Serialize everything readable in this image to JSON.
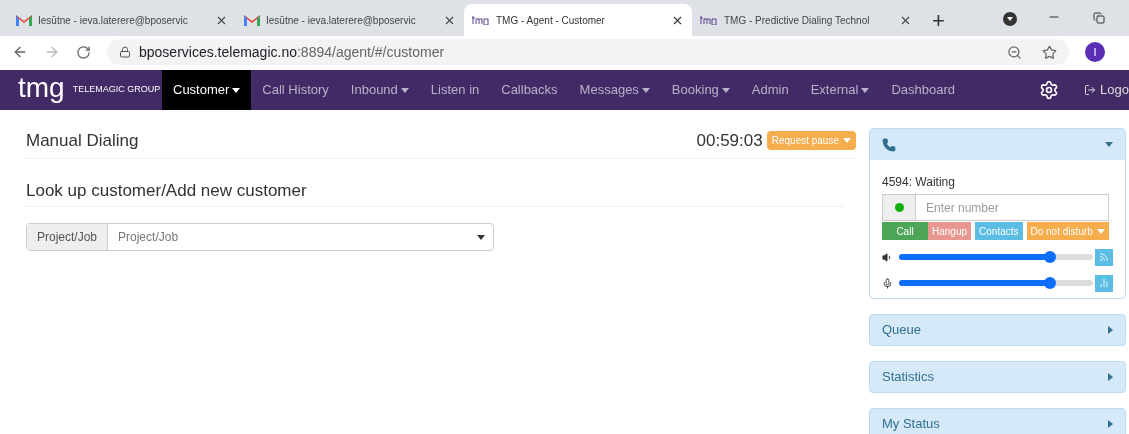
{
  "browser": {
    "tabs": [
      {
        "title": "Iesūtne - ieva.laterere@bposervic",
        "selected": false
      },
      {
        "title": "Iesūtne - ieva.laterere@bposervic",
        "selected": false
      },
      {
        "title": "TMG - Agent - Customer",
        "selected": true
      },
      {
        "title": "TMG - Predictive Dialing Technol",
        "selected": false
      }
    ],
    "new_tab": "+",
    "address": {
      "host": "bposervices.telemagic.no",
      "path": ":8894/agent/#/customer"
    },
    "profile": "I"
  },
  "navbar": {
    "logo": "tmg",
    "logo_subtitle": "TELEMAGIC GROUP",
    "items": [
      {
        "label": "Customer",
        "dropdown": true,
        "selected": true
      },
      {
        "label": "Call History",
        "dropdown": false,
        "selected": false
      },
      {
        "label": "Inbound",
        "dropdown": true,
        "selected": false
      },
      {
        "label": "Listen in",
        "dropdown": false,
        "selected": false
      },
      {
        "label": "Callbacks",
        "dropdown": false,
        "selected": false
      },
      {
        "label": "Messages",
        "dropdown": true,
        "selected": false
      },
      {
        "label": "Booking",
        "dropdown": true,
        "selected": false
      },
      {
        "label": "Admin",
        "dropdown": false,
        "selected": false
      },
      {
        "label": "External",
        "dropdown": true,
        "selected": false
      },
      {
        "label": "Dashboard",
        "dropdown": false,
        "selected": false
      }
    ],
    "logout": "Logo"
  },
  "main": {
    "title": "Manual Dialing",
    "timer": "00:59:03",
    "pause_button": "Request pause",
    "subtitle": "Look up customer/Add new customer",
    "project_addon": "Project/Job",
    "project_placeholder": "Project/Job"
  },
  "phone_panel": {
    "status": "4594: Waiting",
    "number_placeholder": "Enter number",
    "buttons": [
      {
        "label": "Call",
        "kind": "call"
      },
      {
        "label": "Hangup",
        "kind": "hangup"
      },
      {
        "label": "Contacts",
        "kind": "contacts"
      },
      {
        "label": "Do not disturb",
        "kind": "dnd"
      }
    ],
    "sliders": [
      {
        "kind": "speaker",
        "level": 0.78
      },
      {
        "kind": "microphone",
        "level": 0.78
      }
    ]
  },
  "side_panels": [
    {
      "title": "Queue",
      "expanded": false
    },
    {
      "title": "Statistics",
      "expanded": false
    },
    {
      "title": "My Status",
      "expanded": false
    }
  ]
}
